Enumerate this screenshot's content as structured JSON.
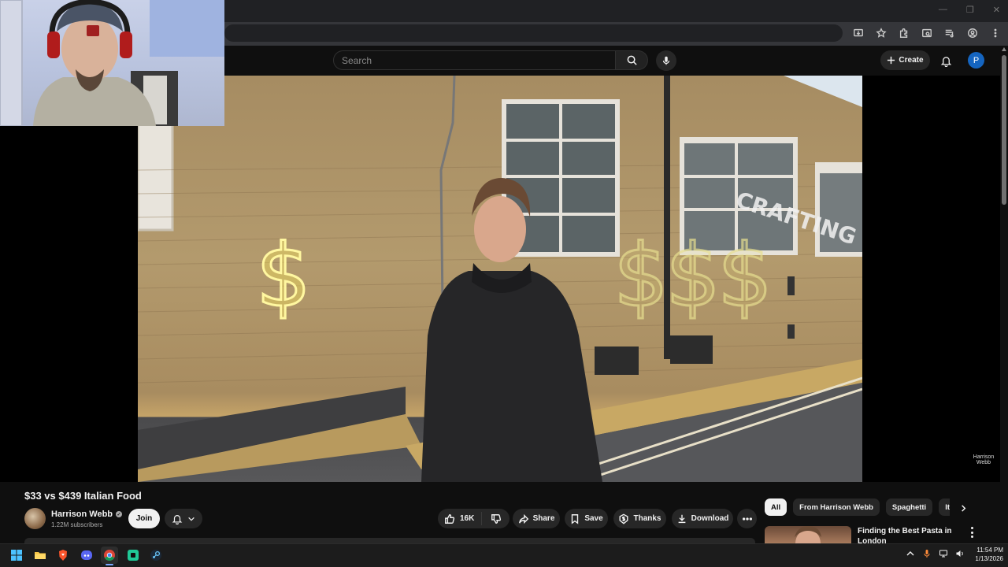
{
  "browser": {
    "window_controls": {
      "minimize": "—",
      "restore": "❐",
      "close": "✕"
    },
    "toolbar_icons": [
      "install-app-icon",
      "bookmark-star-icon",
      "extensions-icon",
      "tab-search-icon",
      "media-controls-icon",
      "profile-icon",
      "chrome-menu-icon"
    ]
  },
  "header": {
    "search_placeholder": "Search",
    "create_label": "Create",
    "avatar_letter": "P",
    "colors": {
      "avatar_bg": "#1565c0",
      "background": "#0f0f0f"
    }
  },
  "player": {
    "watermark_line1": "Harrison",
    "watermark_line2": "Webb",
    "scene": "street-brick-wall-neon-dollar-signs"
  },
  "video": {
    "title": "$33 vs $439 Italian Food",
    "channel": {
      "name": "Harrison Webb",
      "subscribers": "1.22M subscribers",
      "verified": true
    },
    "join_label": "Join",
    "actions": {
      "likes": "16K",
      "share": "Share",
      "save": "Save",
      "thanks": "Thanks",
      "download": "Download"
    }
  },
  "sidebar": {
    "chips": [
      {
        "label": "All",
        "active": true
      },
      {
        "label": "From Harrison Webb",
        "active": false
      },
      {
        "label": "Spaghetti",
        "active": false
      },
      {
        "label": "Italian",
        "active": false
      }
    ],
    "recommendations": [
      {
        "title": "Finding the Best Pasta in London"
      }
    ]
  },
  "taskbar": {
    "apps": [
      "windows-start-icon",
      "file-explorer-icon",
      "brave-browser-icon",
      "discord-icon",
      "chrome-icon",
      "app-icon",
      "steam-icon"
    ],
    "time": "11:54 PM",
    "date": "1/13/2026"
  }
}
